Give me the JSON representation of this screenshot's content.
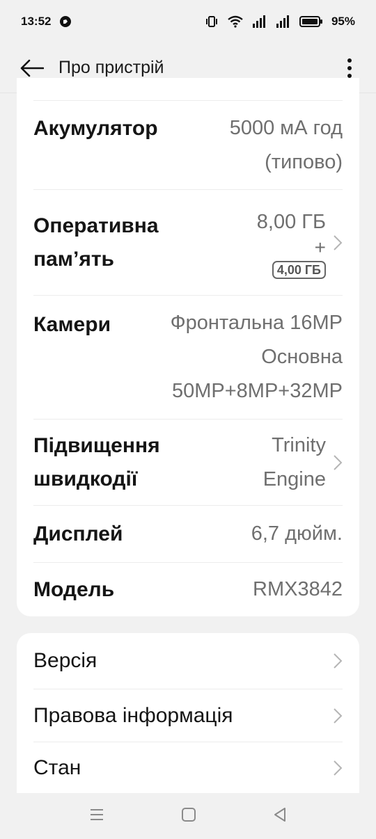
{
  "status_bar": {
    "time": "13:52",
    "battery": "95%"
  },
  "app_bar": {
    "title": "Про пристрій"
  },
  "specs": [
    {
      "label": "Акумулятор",
      "value_lines": [
        "5000 мА год",
        "(типово)"
      ]
    },
    {
      "label_lines": [
        "Оперативна",
        "пам’ять"
      ],
      "value": "8,00 ГБ",
      "plus": "+",
      "badge": "4,00 ГБ"
    },
    {
      "label": "Камери",
      "value_lines": [
        "Фронтальна 16MP",
        "Основна",
        "50MP+8MP+32MP"
      ]
    },
    {
      "label_lines": [
        "Підвищення",
        "швидкодії"
      ],
      "value_lines": [
        "Trinity",
        "Engine"
      ]
    },
    {
      "label": "Дисплей",
      "value": "6,7 дюйм."
    },
    {
      "label": "Модель",
      "value": "RMX3842"
    }
  ],
  "links": [
    {
      "label": "Версія"
    },
    {
      "label": "Правова інформація"
    },
    {
      "label": "Стан"
    }
  ]
}
